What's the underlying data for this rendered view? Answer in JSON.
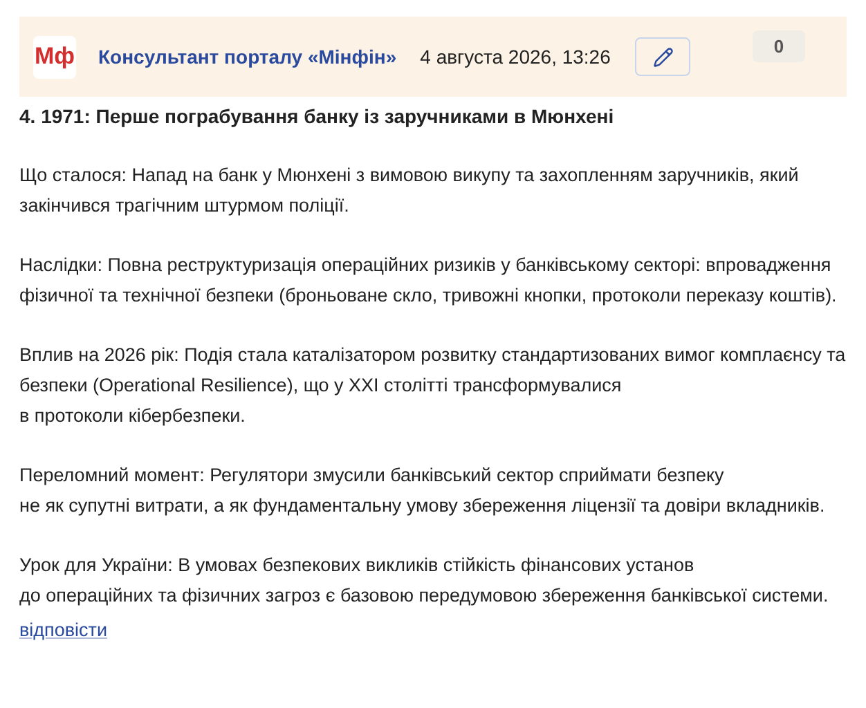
{
  "header": {
    "logo": "Мф",
    "author": "Консультант порталу «Мінфін»",
    "date": "4 августа 2026, 13:26",
    "count": "0"
  },
  "title": "4. 1971: Перше пограбування банку із заручниками в Мюнхені",
  "paragraphs": [
    {
      "lines": [
        "Що сталося: Напад на банк у Мюнхені з вимовою викупу та захопленням заручників, який закінчився трагічним штурмом поліції."
      ]
    },
    {
      "lines": [
        "Наслідки: Повна реструктуризація операційних ризиків у банківському секторі: впровадження фізичної та технічної безпеки (броньоване скло, тривожні кнопки, протоколи переказу коштів)."
      ]
    },
    {
      "lines": [
        "Вплив на 2026 рік: Подія стала каталізатором розвитку стандартизованих вимог комплаєнсу та безпеки (Operational Resilience), що у XXI столітті трансформувалися",
        "в протоколи кібербезпеки."
      ]
    },
    {
      "lines": [
        "Переломний момент: Регулятори змусили банківський сектор сприймати безпеку",
        "не як супутні витрати, а як фундаментальну умову збереження ліцензії та довіри вкладників."
      ]
    },
    {
      "lines": [
        "Урок для України: В умовах безпекових викликів стійкість фінансових установ",
        "до операційних та фізичних загроз є базовою передумовою збереження банківської системи."
      ]
    }
  ],
  "reply_link": "відповісти"
}
